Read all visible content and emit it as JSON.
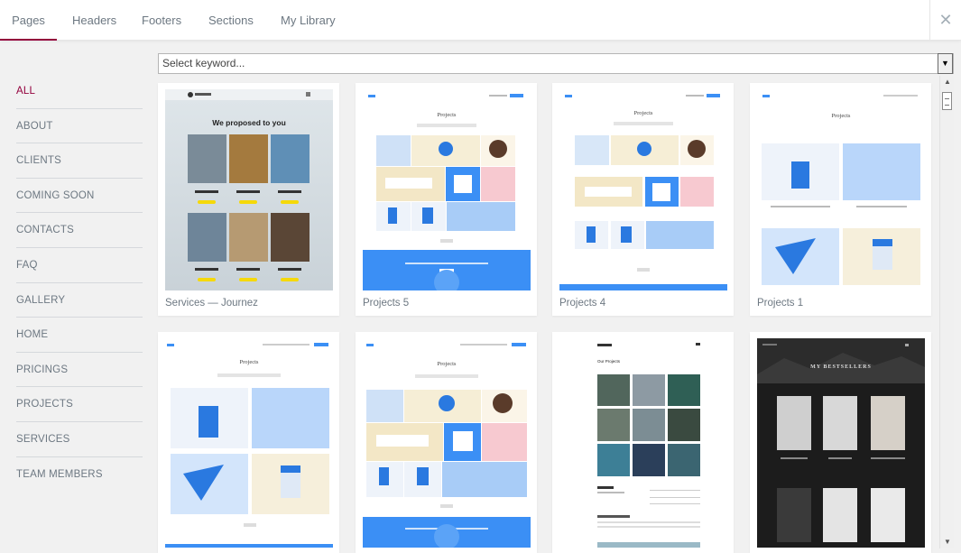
{
  "tabs": [
    {
      "label": "Pages",
      "active": true
    },
    {
      "label": "Headers"
    },
    {
      "label": "Footers"
    },
    {
      "label": "Sections"
    },
    {
      "label": "My Library"
    }
  ],
  "close_icon": "close-icon",
  "sidebar": {
    "items": [
      "ALL",
      "ABOUT",
      "CLIENTS",
      "COMING SOON",
      "CONTACTS",
      "FAQ",
      "GALLERY",
      "HOME",
      "PRICINGS",
      "PROJECTS",
      "SERVICES",
      "TEAM MEMBERS"
    ],
    "active_index": 0
  },
  "search": {
    "placeholder": "Select keyword..."
  },
  "templates": [
    {
      "caption": "Services — Journez",
      "heading": "We proposed to you",
      "btn_color": "#f5d90a"
    },
    {
      "caption": "Projects 5",
      "heading": "Projects"
    },
    {
      "caption": "Projects 4",
      "heading": "Projects"
    },
    {
      "caption": "Projects 1",
      "heading": "Projects"
    },
    {
      "caption": "",
      "heading": "Projects"
    },
    {
      "caption": "",
      "heading": "Projects"
    },
    {
      "caption": "",
      "heading": "Our Projects"
    },
    {
      "caption": "",
      "heading": "MY BESTSELLERS"
    }
  ],
  "colors": {
    "accent": "#93003c",
    "blue": "#3b8ff5"
  }
}
